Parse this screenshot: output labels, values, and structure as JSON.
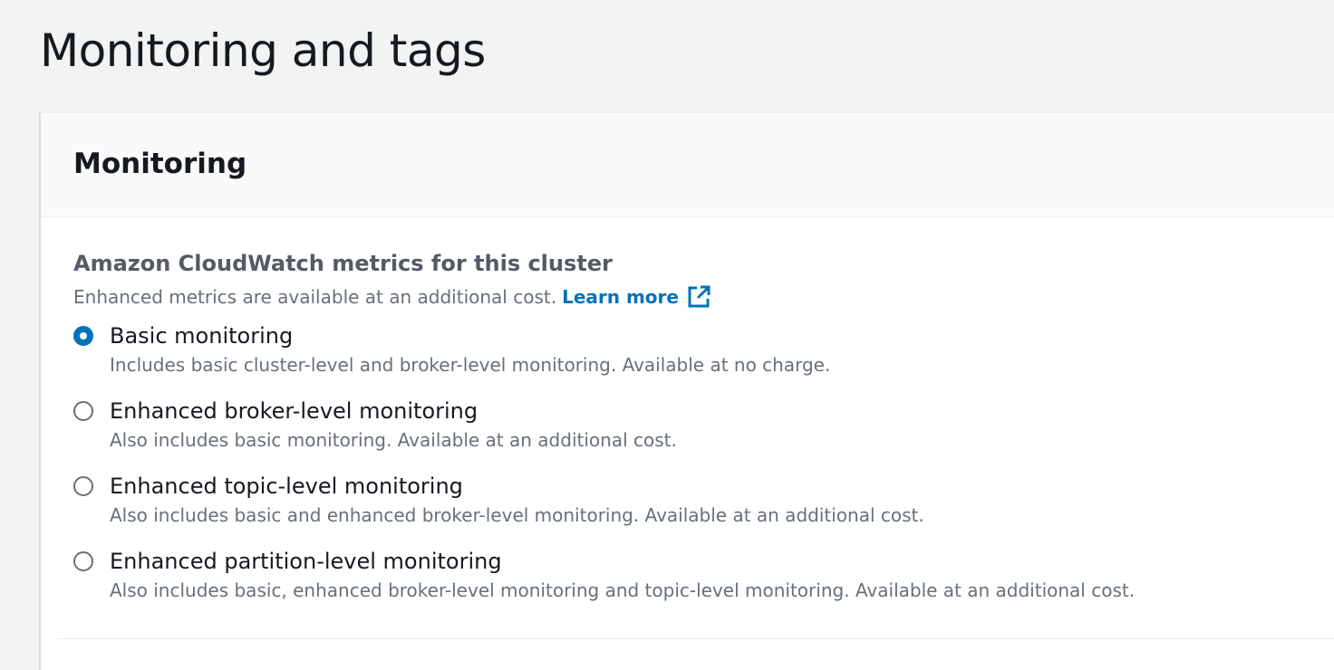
{
  "page": {
    "title": "Monitoring and tags"
  },
  "monitoring": {
    "heading": "Monitoring",
    "field_label": "Amazon CloudWatch metrics for this cluster",
    "field_description": "Enhanced metrics are available at an additional cost.",
    "learn_more_label": "Learn more",
    "learn_more_icon": "external-link-icon",
    "accent_color": "#0073bb",
    "selected_option": "Basic monitoring",
    "options": [
      {
        "label": "Basic monitoring",
        "description": "Includes basic cluster-level and broker-level monitoring. Available at no charge.",
        "checked": true
      },
      {
        "label": "Enhanced broker-level monitoring",
        "description": "Also includes basic monitoring. Available at an additional cost.",
        "checked": false
      },
      {
        "label": "Enhanced topic-level monitoring",
        "description": "Also includes basic and enhanced broker-level monitoring. Available at an additional cost.",
        "checked": false
      },
      {
        "label": "Enhanced partition-level monitoring",
        "description": "Also includes basic, enhanced broker-level monitoring and topic-level monitoring. Available at an additional cost.",
        "checked": false
      }
    ]
  }
}
